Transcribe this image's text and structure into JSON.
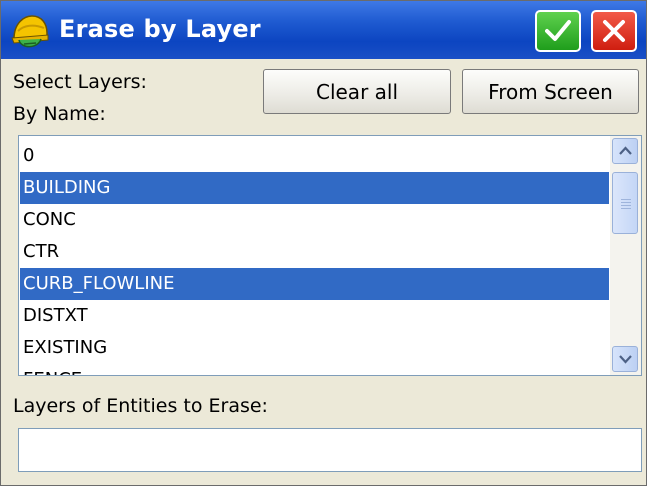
{
  "window": {
    "title": "Erase by Layer",
    "app_icon": "helmet-icon",
    "ok_icon": "checkmark-icon",
    "close_icon": "close-icon"
  },
  "labels": {
    "select_layers": "Select Layers:",
    "by_name": "By Name:",
    "layers_to_erase": "Layers of Entities to Erase:"
  },
  "buttons": {
    "clear_all": "Clear all",
    "from_screen": "From Screen"
  },
  "layer_list": {
    "items": [
      {
        "label": "0",
        "selected": false
      },
      {
        "label": "BUILDING",
        "selected": true
      },
      {
        "label": "CONC",
        "selected": false
      },
      {
        "label": "CTR",
        "selected": false
      },
      {
        "label": "CURB_FLOWLINE",
        "selected": true
      },
      {
        "label": "DISTXT",
        "selected": false
      },
      {
        "label": "EXISTING",
        "selected": false
      },
      {
        "label": "FENCE",
        "selected": false
      }
    ]
  },
  "erase_field": {
    "value": ""
  },
  "colors": {
    "titlebar": "#0c45c1",
    "selection": "#316ac5",
    "ok_button": "#1f9e1c",
    "close_button": "#cf1e10",
    "dialog_bg": "#ece9d8"
  }
}
